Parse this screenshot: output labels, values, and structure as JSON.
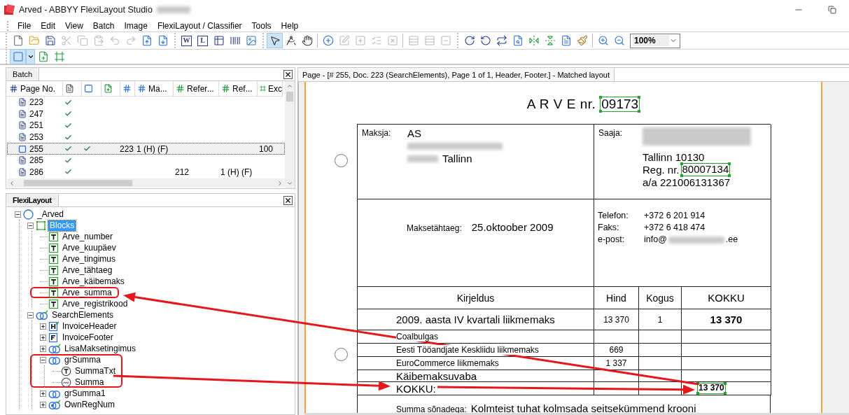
{
  "window": {
    "title": "Arved - ABBYY FlexiLayout Studio"
  },
  "menu": [
    "File",
    "Edit",
    "View",
    "Batch",
    "Image",
    "FlexiLayout / Classifier",
    "Tools",
    "Help"
  ],
  "toolbar": {
    "groups": [
      [
        {
          "kind": "new",
          "disabled": false
        },
        {
          "kind": "open",
          "disabled": false
        },
        {
          "kind": "save",
          "disabled": false
        },
        {
          "kind": "cut",
          "disabled": true
        },
        {
          "kind": "copy",
          "disabled": true
        },
        {
          "kind": "paste",
          "disabled": true
        },
        {
          "kind": "undo",
          "disabled": true
        },
        {
          "kind": "redo",
          "disabled": true
        },
        {
          "kind": "import",
          "disabled": false
        },
        {
          "kind": "export",
          "disabled": false
        }
      ],
      [
        {
          "kind": "letter",
          "label": "W",
          "disabled": false
        },
        {
          "kind": "letter",
          "label": "L",
          "disabled": false
        },
        {
          "kind": "table",
          "disabled": false
        },
        {
          "kind": "barcode",
          "disabled": false
        },
        {
          "kind": "picture",
          "disabled": false
        }
      ],
      [
        {
          "kind": "pointer",
          "disabled": false,
          "selected": true
        },
        {
          "kind": "compass",
          "disabled": false,
          "selected": false
        },
        {
          "kind": "hand",
          "disabled": false,
          "selected": false
        },
        {
          "kind": "separator"
        },
        {
          "kind": "element",
          "disabled": false
        },
        {
          "kind": "edit",
          "disabled": true
        },
        {
          "kind": "box-plus",
          "disabled": true
        },
        {
          "kind": "box-list",
          "disabled": true
        },
        {
          "kind": "box-x",
          "disabled": true
        },
        {
          "kind": "separator"
        },
        {
          "kind": "rows-plus",
          "disabled": true
        },
        {
          "kind": "rows-plus",
          "disabled": true
        },
        {
          "kind": "rows-minus",
          "disabled": true
        }
      ],
      [
        {
          "kind": "rotate-cw",
          "disabled": false
        },
        {
          "kind": "rotate-ccw",
          "disabled": false
        },
        {
          "kind": "page-rotate",
          "disabled": false
        },
        {
          "kind": "help-doc",
          "disabled": false
        },
        {
          "kind": "mirror-h",
          "disabled": false
        },
        {
          "kind": "mirror-v",
          "disabled": false
        },
        {
          "kind": "doc",
          "disabled": false
        },
        {
          "kind": "brush",
          "disabled": false
        },
        {
          "kind": "separator"
        },
        {
          "kind": "zoom-in",
          "disabled": false
        },
        {
          "kind": "zoom-out",
          "disabled": false
        }
      ]
    ],
    "zoom": "100%"
  },
  "toolbar2": [
    {
      "kind": "block-select",
      "selected": true
    },
    {
      "kind": "add-page",
      "selected": false
    },
    {
      "kind": "region",
      "selected": false
    }
  ],
  "batch": {
    "title": "Batch",
    "columns": [
      {
        "kind": "text",
        "label": "Page No."
      },
      {
        "kind": "icon"
      },
      {
        "kind": "icon"
      },
      {
        "kind": "icon"
      },
      {
        "kind": "icon"
      },
      {
        "kind": "text",
        "label": "Ma..."
      },
      {
        "kind": "text",
        "label": "Refer..."
      },
      {
        "kind": "text",
        "label": "Ref..."
      },
      {
        "kind": "text",
        "label": "Exc"
      }
    ],
    "rows": [
      {
        "page": "223",
        "selected": false,
        "checks": [
          true,
          false
        ]
      },
      {
        "page": "247",
        "selected": false,
        "checks": [
          true,
          false
        ]
      },
      {
        "page": "251",
        "selected": false,
        "checks": [
          true,
          false
        ]
      },
      {
        "page": "253",
        "selected": false,
        "checks": [
          true,
          false
        ]
      },
      {
        "page": "255",
        "selected": true,
        "checks": [
          true,
          true
        ],
        "column_5": "223",
        "ma": "1 (H) (F)",
        "exc": "100"
      },
      {
        "page": "285",
        "selected": false,
        "checks": [
          true,
          false
        ]
      },
      {
        "page": "286",
        "selected": false,
        "checks": [
          true,
          false
        ],
        "refer": "212",
        "ref": "1 (H) (F)"
      }
    ]
  },
  "flexilayout": {
    "title": "FlexiLayout",
    "tree": {
      "label": "_Arved",
      "kind": "layout",
      "expanded": true,
      "selected": false,
      "highlighted": false,
      "children": [
        {
          "label": "Blocks",
          "kind": "blocks",
          "expanded": true,
          "selected": true,
          "highlighted": false,
          "children": [
            {
              "label": "Arve_number",
              "kind": "text-block",
              "selected": false,
              "highlighted": false
            },
            {
              "label": "Arve_kuupäev",
              "kind": "text-block",
              "selected": false,
              "highlighted": false
            },
            {
              "label": "Arve_tingimus",
              "kind": "text-block",
              "selected": false,
              "highlighted": false
            },
            {
              "label": "Arve_tähtaeg",
              "kind": "text-block",
              "selected": false,
              "highlighted": false
            },
            {
              "label": "Arve_käibemaks",
              "kind": "text-block",
              "selected": false,
              "highlighted": false
            },
            {
              "label": "Arve_summa",
              "kind": "text-block",
              "selected": false,
              "highlighted": true
            },
            {
              "label": "Arve_registrikood",
              "kind": "text-block",
              "selected": false,
              "highlighted": false
            }
          ]
        },
        {
          "label": "SearchElements",
          "kind": "search-group",
          "expanded": true,
          "selected": false,
          "highlighted": false,
          "children": [
            {
              "label": "InvoiceHeader",
              "kind": "header",
              "expanded": false,
              "selected": false,
              "highlighted": false
            },
            {
              "label": "InvoiceFooter",
              "kind": "footer",
              "expanded": false,
              "selected": false,
              "highlighted": false
            },
            {
              "label": "LisaMaksetingimus",
              "kind": "search-group",
              "expanded": false,
              "selected": false,
              "highlighted": false
            },
            {
              "label": "grSumma",
              "kind": "group",
              "expanded": true,
              "selected": false,
              "highlighted": true,
              "children": [
                {
                  "label": "SummaTxt",
                  "kind": "static-text",
                  "selected": false,
                  "highlighted": false
                },
                {
                  "label": "Summa",
                  "kind": "character-string",
                  "selected": false,
                  "highlighted": false
                }
              ]
            },
            {
              "label": "grSumma1",
              "kind": "group",
              "expanded": false,
              "selected": false,
              "highlighted": false
            },
            {
              "label": "OwnRegNum",
              "kind": "reg-group",
              "expanded": false,
              "selected": false,
              "highlighted": false
            }
          ]
        }
      ]
    }
  },
  "document": {
    "tab": "Page - [# 255, Doc. 223 (SearchElements), Page 1 of 1, Header, Footer.] - Matched layout",
    "title": "A R V E  nr.",
    "number": "09173",
    "payer": {
      "label": "Maksja:",
      "name": "AS",
      "city": "Tallinn"
    },
    "recipient": {
      "label": "Saaja:",
      "city": "Tallinn 10130",
      "reg_label": "Reg. nr.",
      "reg_number": "80007134",
      "account": "a/a 221006131367"
    },
    "due": {
      "label": "Maksetähtaeg:",
      "value": "25.oktoober 2009"
    },
    "contacts": [
      {
        "label": "Telefon:",
        "value": "+372 6 201 914"
      },
      {
        "label": "Faks:",
        "value": "+372 6 418 474"
      },
      {
        "label": "e-post:",
        "value": "info@",
        "suffix": ".ee"
      }
    ],
    "items": {
      "columns": [
        "Kirjeldus",
        "Hind",
        "Kogus",
        "KOKKU"
      ],
      "rows": [
        {
          "kind": "line",
          "description": "2009. aasta IV kvartali liikmemaks",
          "price": "13 370",
          "quantity": "1",
          "total": "13 370"
        },
        {
          "kind": "detail",
          "description": "Coalbulgas"
        },
        {
          "kind": "detail",
          "description": "Eesti Tööandjate Keskliidu liikmemaks",
          "price": "669"
        },
        {
          "kind": "detail",
          "description": "EuroCommerce liikmemaks",
          "price": "1 337"
        },
        {
          "kind": "line",
          "description": "Käibemaksuvaba"
        }
      ],
      "total_label": "KOKKU:",
      "total": "13 370"
    },
    "words": {
      "label": "Summa sõnadega:",
      "value": "Kolmteist tuhat kolmsada seitsekümmend krooni"
    }
  }
}
